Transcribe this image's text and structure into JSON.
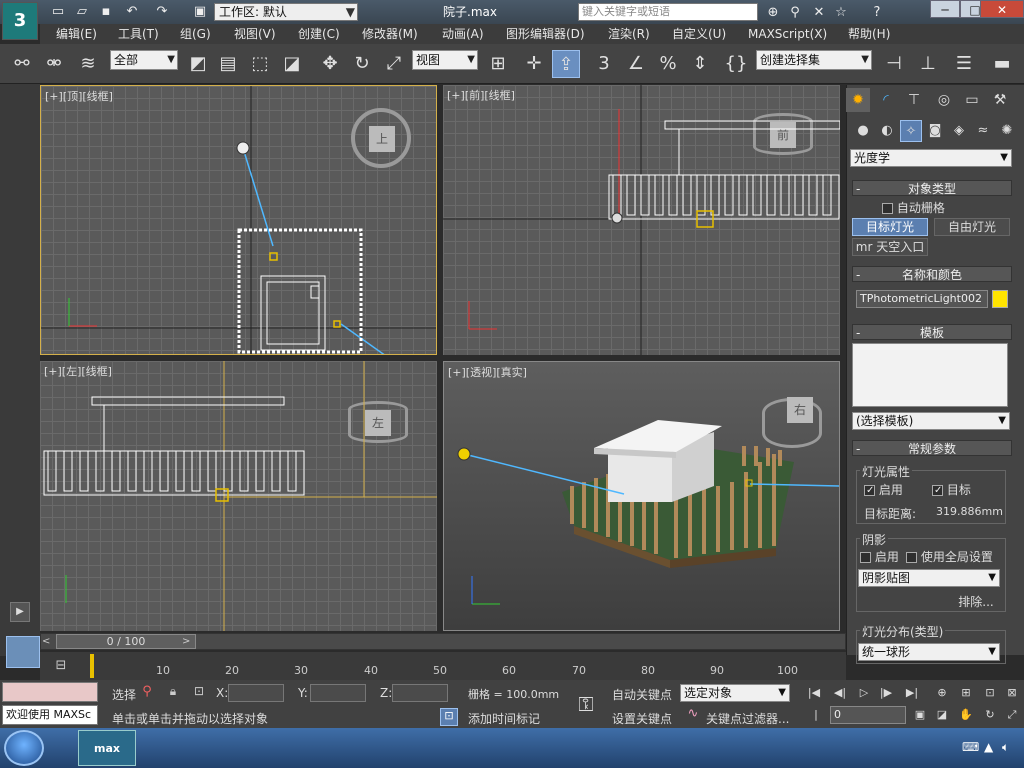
{
  "titlebar": {
    "app_logo": "3",
    "workspace": "工作区: 默认",
    "doc_title": "院子.max",
    "search_placeholder": "键入关键字或短语",
    "win_min": "─",
    "win_max": "□",
    "win_close": "✕"
  },
  "menus": [
    "编辑(E)",
    "工具(T)",
    "组(G)",
    "视图(V)",
    "创建(C)",
    "修改器(M)",
    "动画(A)",
    "图形编辑器(D)",
    "渲染(R)",
    "自定义(U)",
    "MAXScript(X)",
    "帮助(H)"
  ],
  "toolbar": {
    "selection_filter": "全部",
    "ref_coord": "视图",
    "named_selection": "创建选择集"
  },
  "viewports": {
    "top": {
      "label": "[+][顶][线框]",
      "cube": "上"
    },
    "front": {
      "label": "[+][前][线框]",
      "cube": "前"
    },
    "left": {
      "label": "[+][左][线框]",
      "cube": "左"
    },
    "persp": {
      "label": "[+][透视][真实]",
      "cube": "右"
    }
  },
  "command_panel": {
    "category": "光度学",
    "object_type": {
      "title": "对象类型",
      "autogrid": "自动栅格",
      "target_light": "目标灯光",
      "free_light": "自由灯光",
      "mr_sky": "mr 天空入口"
    },
    "name_color": {
      "title": "名称和颜色",
      "name": "TPhotometricLight002",
      "color": "#ffe400"
    },
    "templates": {
      "title": "模板",
      "select": "(选择模板)"
    },
    "general": {
      "title": "常规参数",
      "light_props": "灯光属性",
      "enable": "启用",
      "target": "目标",
      "target_dist_label": "目标距离:",
      "target_dist_value": "319.886mm",
      "shadows": "阴影",
      "shadow_enable": "启用",
      "use_global": "使用全局设置",
      "shadow_type": "阴影贴图",
      "exclude": "排除...",
      "dist_title": "灯光分布(类型)",
      "dist_type": "统一球形"
    }
  },
  "timeline": {
    "position": "0 / 100",
    "ticks": [
      "10",
      "20",
      "30",
      "40",
      "50",
      "60",
      "70",
      "80",
      "90",
      "100"
    ]
  },
  "status": {
    "welcome": "欢迎使用 MAXSc",
    "selected_label": "选择",
    "prompt": "单击或单击并拖动以选择对象",
    "add_time_tag": "添加时间标记",
    "x_label": "X:",
    "y_label": "Y:",
    "z_label": "Z:",
    "grid": "栅格 = 100.0mm",
    "auto_key": "自动关键点",
    "set_key": "设置关键点",
    "key_filter_dd": "选定对象",
    "key_filters": "关键点过滤器...",
    "frame": "0"
  },
  "taskbar": {
    "max_label": "max"
  }
}
